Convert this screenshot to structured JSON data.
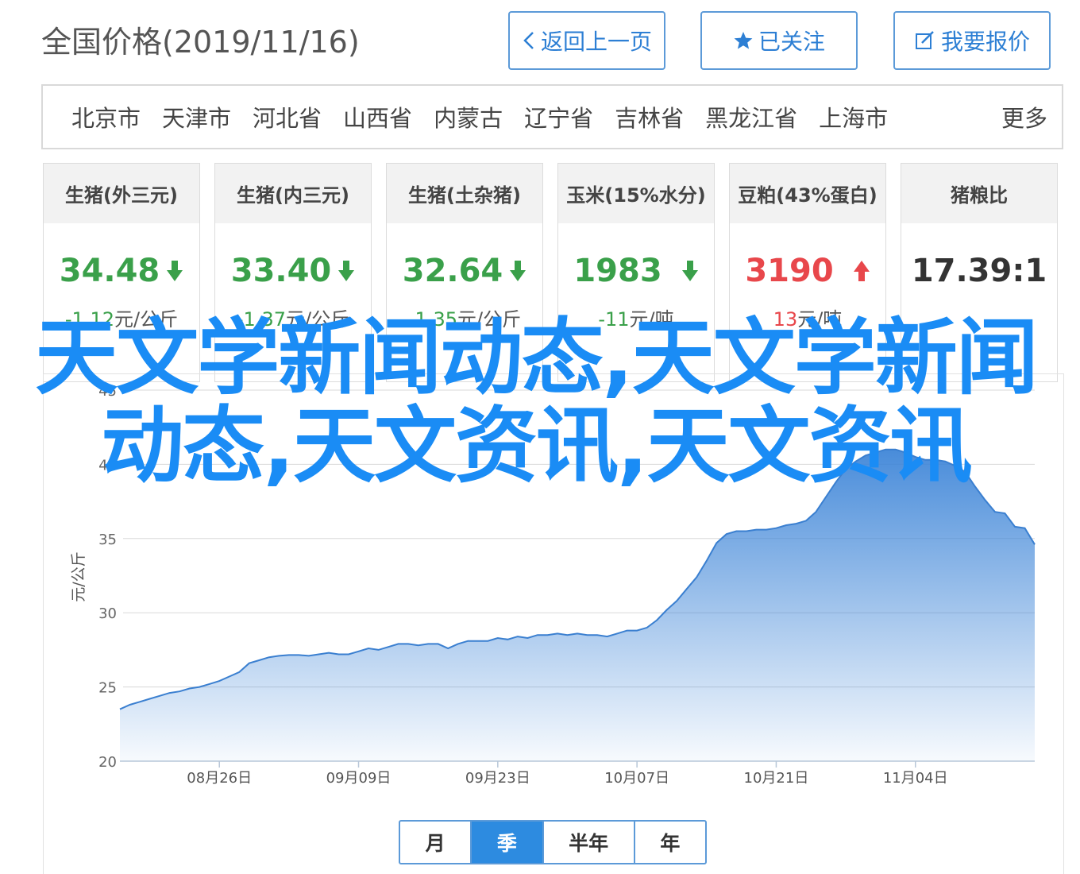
{
  "header": {
    "title": "全国价格(2019/11/16)",
    "back_label": "返回上一页",
    "follow_label": "已关注",
    "report_label": "我要报价"
  },
  "regions": {
    "items": [
      "北京市",
      "天津市",
      "河北省",
      "山西省",
      "内蒙古",
      "辽宁省",
      "吉林省",
      "黑龙江省",
      "上海市"
    ],
    "more_label": "更多"
  },
  "cards": [
    {
      "title": "生猪(外三元)",
      "value": "34.48",
      "trend": "down",
      "change": "-1.12",
      "unit": "元/公斤"
    },
    {
      "title": "生猪(内三元)",
      "value": "33.40",
      "trend": "down",
      "change": "-1.37",
      "unit": "元/公斤"
    },
    {
      "title": "生猪(土杂猪)",
      "value": "32.64",
      "trend": "down",
      "change": "-1.35",
      "unit": "元/公斤"
    },
    {
      "title": "玉米(15%水分)",
      "value": "1983",
      "trend": "down",
      "change": "-11",
      "unit": "元/吨"
    },
    {
      "title": "豆粕(43%蛋白)",
      "value": "3190",
      "trend": "up",
      "change": "13",
      "unit": "元/吨"
    },
    {
      "title": "猪粮比",
      "value": "17.39:1",
      "trend": "none",
      "change": "",
      "unit": ""
    }
  ],
  "colors": {
    "accent": "#2d8be0",
    "down": "#3aa04a",
    "up": "#e8474b",
    "overlay_text": "#1a8cf5",
    "series_line": "#3a7fd0"
  },
  "overlay": {
    "text": "天文学新闻动态,天文学新闻动态,天文资讯,天文资讯"
  },
  "chart_data": {
    "type": "area",
    "ylabel": "元/公斤",
    "ylim": [
      20,
      45
    ],
    "yticks": [
      20,
      25,
      30,
      35,
      40,
      45
    ],
    "x_range": [
      "2019-08-16",
      "2019-11-16"
    ],
    "xticks": [
      {
        "date": "2019-08-26",
        "label": "08月26日"
      },
      {
        "date": "2019-09-09",
        "label": "09月09日"
      },
      {
        "date": "2019-09-23",
        "label": "09月23日"
      },
      {
        "date": "2019-10-07",
        "label": "10月07日"
      },
      {
        "date": "2019-10-21",
        "label": "10月21日"
      },
      {
        "date": "2019-11-04",
        "label": "11月04日"
      }
    ],
    "grid": true,
    "series": [
      {
        "dates": [
          "2019-08-16",
          "2019-08-17",
          "2019-08-18",
          "2019-08-19",
          "2019-08-20",
          "2019-08-21",
          "2019-08-22",
          "2019-08-23",
          "2019-08-24",
          "2019-08-25",
          "2019-08-26",
          "2019-08-27",
          "2019-08-28",
          "2019-08-29",
          "2019-08-30",
          "2019-08-31",
          "2019-09-01",
          "2019-09-02",
          "2019-09-03",
          "2019-09-04",
          "2019-09-05",
          "2019-09-06",
          "2019-09-07",
          "2019-09-08",
          "2019-09-09",
          "2019-09-10",
          "2019-09-11",
          "2019-09-12",
          "2019-09-13",
          "2019-09-14",
          "2019-09-15",
          "2019-09-16",
          "2019-09-17",
          "2019-09-18",
          "2019-09-19",
          "2019-09-20",
          "2019-09-21",
          "2019-09-22",
          "2019-09-23",
          "2019-09-24",
          "2019-09-25",
          "2019-09-26",
          "2019-09-27",
          "2019-09-28",
          "2019-09-29",
          "2019-09-30",
          "2019-10-01",
          "2019-10-02",
          "2019-10-03",
          "2019-10-04",
          "2019-10-05",
          "2019-10-06",
          "2019-10-07",
          "2019-10-08",
          "2019-10-09",
          "2019-10-10",
          "2019-10-11",
          "2019-10-12",
          "2019-10-13",
          "2019-10-14",
          "2019-10-15",
          "2019-10-16",
          "2019-10-17",
          "2019-10-18",
          "2019-10-19",
          "2019-10-20",
          "2019-10-21",
          "2019-10-22",
          "2019-10-23",
          "2019-10-24",
          "2019-10-25",
          "2019-10-26",
          "2019-10-27",
          "2019-10-28",
          "2019-10-29",
          "2019-10-30",
          "2019-10-31",
          "2019-11-01",
          "2019-11-02",
          "2019-11-03",
          "2019-11-04",
          "2019-11-05",
          "2019-11-06",
          "2019-11-07",
          "2019-11-08",
          "2019-11-09",
          "2019-11-10",
          "2019-11-11",
          "2019-11-12",
          "2019-11-13",
          "2019-11-14",
          "2019-11-15",
          "2019-11-16"
        ],
        "values": [
          23.5,
          23.8,
          24.0,
          24.2,
          24.4,
          24.6,
          24.7,
          24.9,
          25.0,
          25.2,
          25.4,
          25.7,
          26.0,
          26.6,
          26.8,
          27.0,
          27.1,
          27.15,
          27.15,
          27.1,
          27.2,
          27.3,
          27.2,
          27.2,
          27.4,
          27.6,
          27.5,
          27.7,
          27.9,
          27.9,
          27.8,
          27.9,
          27.9,
          27.6,
          27.9,
          28.1,
          28.1,
          28.1,
          28.3,
          28.2,
          28.4,
          28.3,
          28.5,
          28.5,
          28.6,
          28.5,
          28.6,
          28.5,
          28.5,
          28.4,
          28.6,
          28.8,
          28.8,
          29.0,
          29.5,
          30.2,
          30.8,
          31.6,
          32.4,
          33.5,
          34.7,
          35.3,
          35.5,
          35.5,
          35.6,
          35.6,
          35.7,
          35.9,
          36.0,
          36.2,
          36.8,
          37.8,
          38.8,
          39.7,
          40.2,
          40.6,
          40.8,
          41.0,
          41.0,
          40.8,
          40.5,
          40.3,
          40.3,
          40.2,
          39.9,
          39.5,
          38.5,
          37.6,
          36.8,
          36.7,
          35.8,
          35.7,
          34.6
        ]
      }
    ]
  },
  "periods": {
    "items": [
      "月",
      "季",
      "半年",
      "年"
    ],
    "active": "季"
  }
}
